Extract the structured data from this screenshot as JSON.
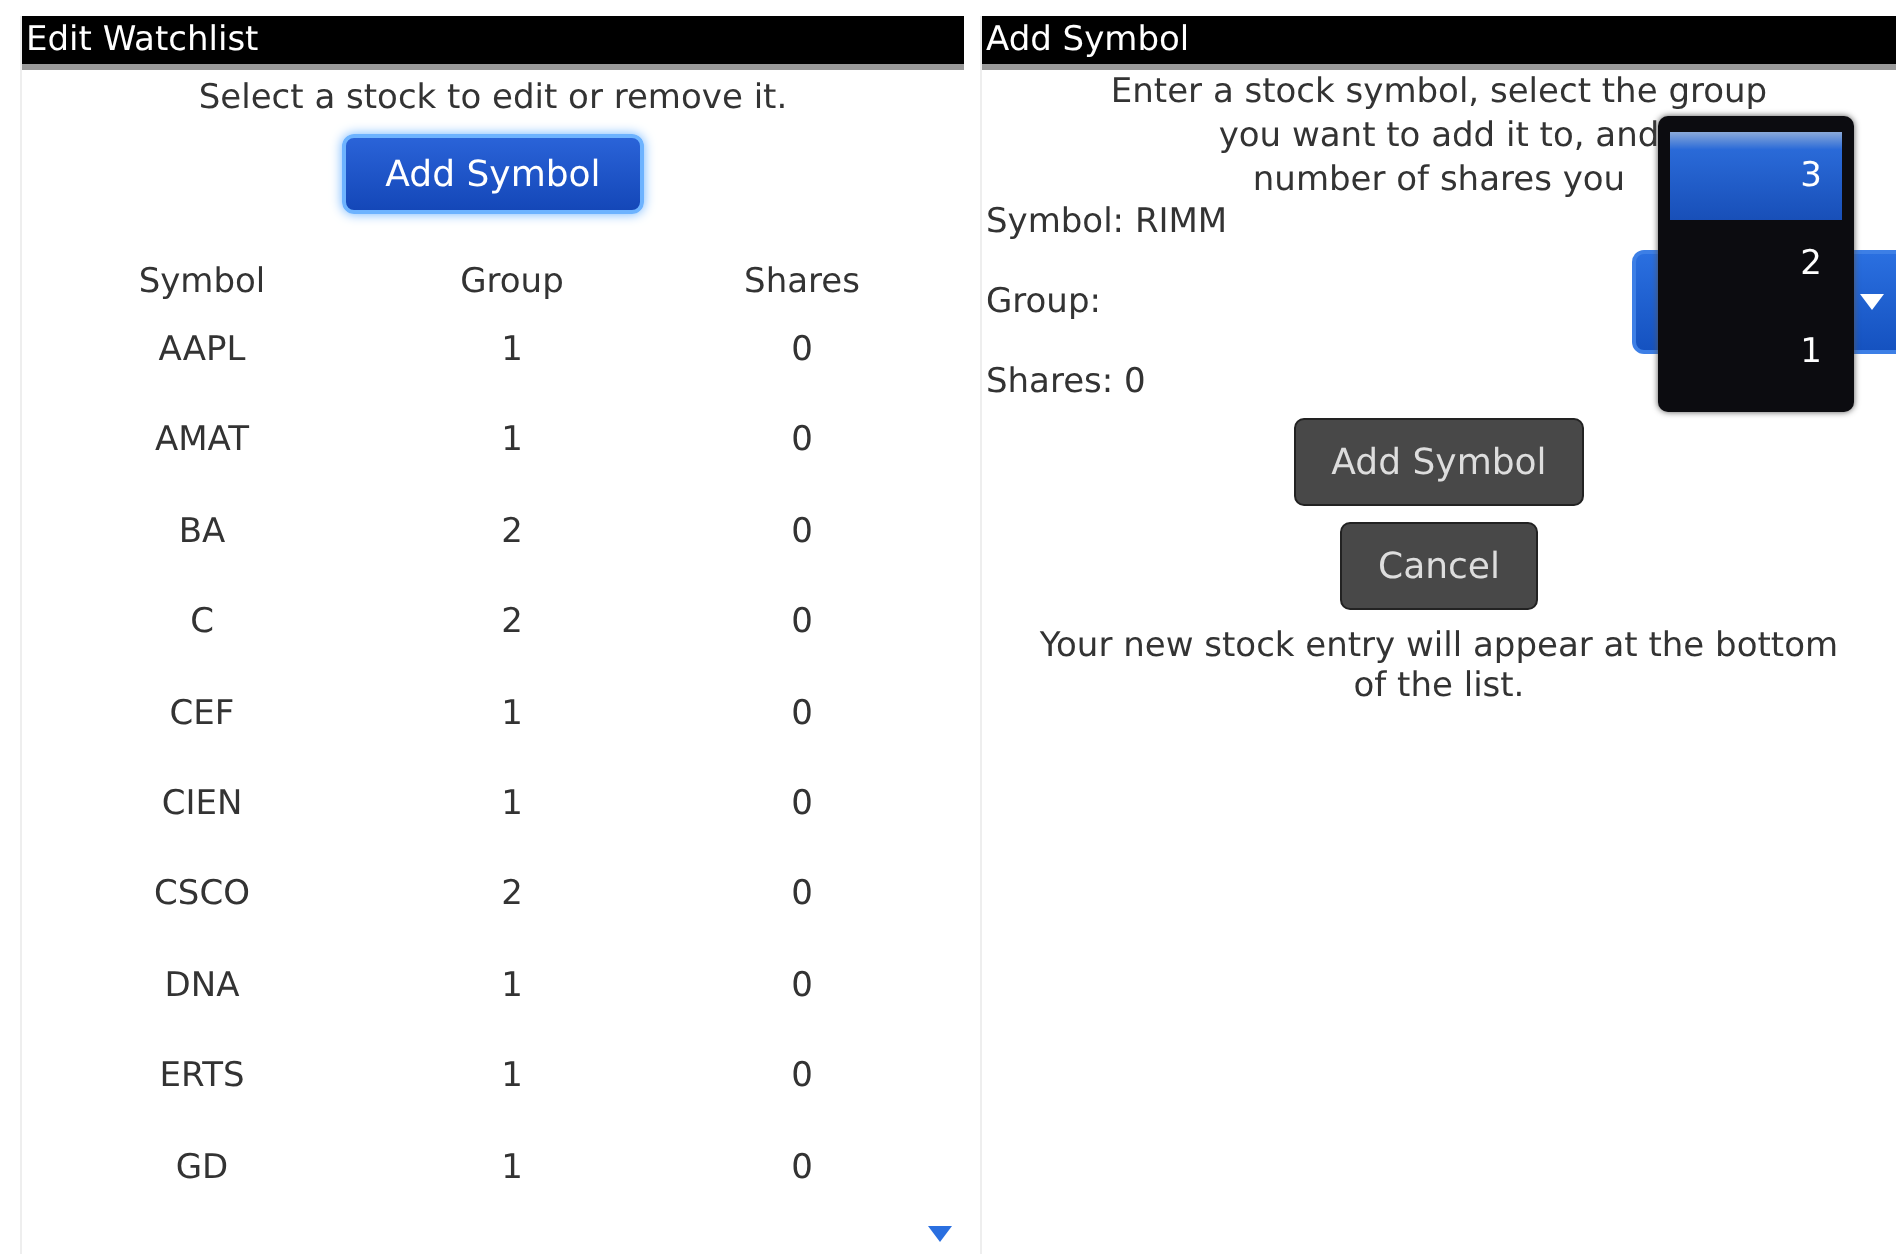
{
  "screens": [
    {
      "title": "Edit Watchlist",
      "instructions": "Select a stock to edit or remove it.",
      "add_button": {
        "label": "Add Symbol",
        "focused": true
      },
      "table": {
        "columns": [
          "Symbol",
          "Group",
          "Shares"
        ],
        "rows": [
          [
            "AAPL",
            "1",
            "0"
          ],
          [
            "AMAT",
            "1",
            "0"
          ],
          [
            "BA",
            "2",
            "0"
          ],
          [
            "C",
            "2",
            "0"
          ],
          [
            "CEF",
            "1",
            "0"
          ],
          [
            "CIEN",
            "1",
            "0"
          ],
          [
            "CSCO",
            "2",
            "0"
          ],
          [
            "DNA",
            "1",
            "0"
          ],
          [
            "ERTS",
            "1",
            "0"
          ],
          [
            "GD",
            "1",
            "0"
          ]
        ]
      },
      "more_below": true
    },
    {
      "title": "Add Symbol",
      "instruction_lines": [
        "Enter a stock symbol, select the group",
        "you want to add it to, and",
        "number of shares you"
      ],
      "symbol_field": "Symbol: RIMM",
      "group_label": "Group:",
      "shares_field": "Shares: 0",
      "group_options": [
        {
          "label": "3",
          "selected": true
        },
        {
          "label": "2",
          "selected": false
        },
        {
          "label": "1",
          "selected": false
        }
      ],
      "buttons": [
        {
          "label": "Add Symbol",
          "focused": false
        },
        {
          "label": "Cancel",
          "focused": false
        }
      ],
      "note": "Your new stock entry will appear at the bottom of the list."
    }
  ]
}
